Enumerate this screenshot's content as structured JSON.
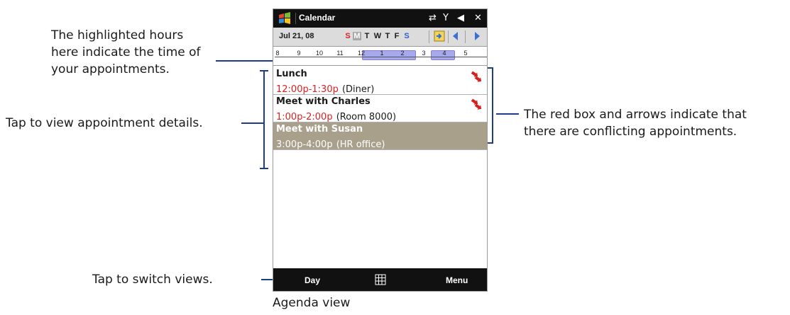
{
  "annotations": {
    "hours_line1": "The highlighted hours",
    "hours_line2": "here indicate the time of",
    "hours_line3": "your appointments.",
    "details": "Tap to view appointment details.",
    "conflict_line1": "The red box and arrows indicate that",
    "conflict_line2": "there are conflicting appointments.",
    "views": "Tap to switch views."
  },
  "caption": "Agenda view",
  "titlebar": {
    "title": "Calendar",
    "icons": [
      "windows-start-icon",
      "sync-icon",
      "signal-icon",
      "volume-icon",
      "close-icon"
    ],
    "close": "✕",
    "signal": "Y",
    "sync": "⇄",
    "volume": "◀"
  },
  "datebar": {
    "date": "Jul 21, 08",
    "weekdays": [
      "S",
      "M",
      "T",
      "W",
      "T",
      "F",
      "S"
    ],
    "today_index": 1
  },
  "hourbar": {
    "hours": [
      "8",
      "9",
      "10",
      "11",
      "12",
      "1",
      "2",
      "3",
      "4",
      "5"
    ]
  },
  "appointments": [
    {
      "title": "Lunch",
      "time": "12:00p-1:30p",
      "location": "(Diner)",
      "conflict": true,
      "selected": false
    },
    {
      "title": "Meet with Charles",
      "time": "1:00p-2:00p",
      "location": "(Room 8000)",
      "conflict": true,
      "selected": false
    },
    {
      "title": "Meet with Susan",
      "time": "3:00p-4:00p",
      "location": "(HR office)",
      "conflict": false,
      "selected": true
    }
  ],
  "softkeys": {
    "left": "Day",
    "right": "Menu"
  },
  "colors": {
    "accent": "#1f3c88",
    "time_red": "#e02020",
    "selected_bg": "#a8a08a",
    "highlight_hours": "#a8a8ee",
    "sunday": "#e02020",
    "saturday": "#2f5fd0"
  }
}
